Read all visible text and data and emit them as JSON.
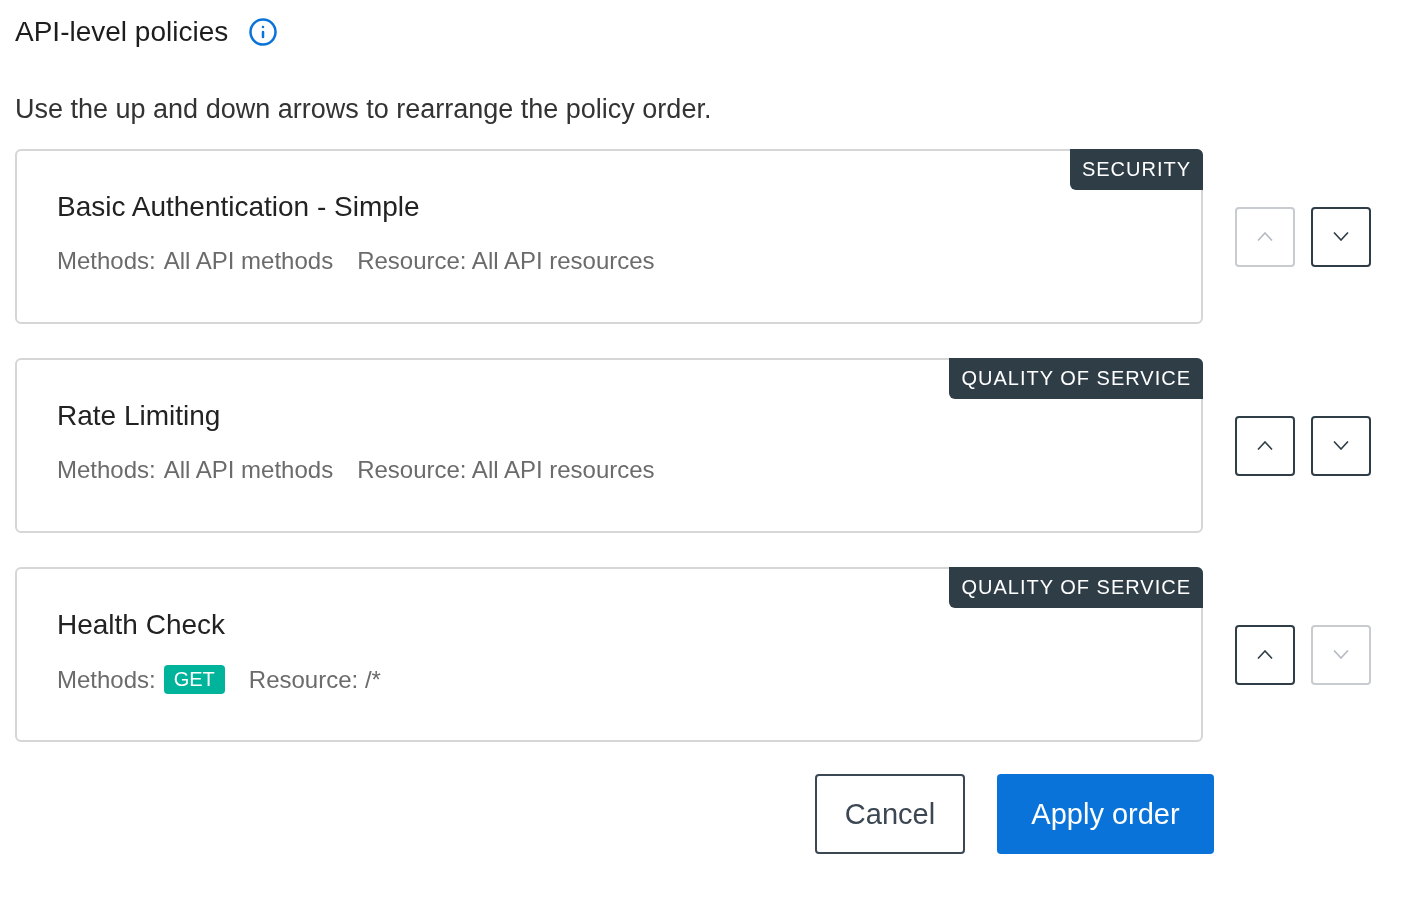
{
  "header": {
    "title": "API-level policies"
  },
  "instructions": "Use the up and down arrows to rearrange the policy order.",
  "policies": [
    {
      "name": "Basic Authentication - Simple",
      "category": "SECURITY",
      "methods_label": "Methods:",
      "methods": [
        {
          "kind": "text",
          "text": "All API methods"
        }
      ],
      "resource": "Resource: All API resources",
      "up_disabled": true,
      "down_disabled": false
    },
    {
      "name": "Rate Limiting",
      "category": "QUALITY OF SERVICE",
      "methods_label": "Methods:",
      "methods": [
        {
          "kind": "text",
          "text": "All API methods"
        }
      ],
      "resource": "Resource: All API resources",
      "up_disabled": false,
      "down_disabled": false
    },
    {
      "name": "Health Check",
      "category": "QUALITY OF SERVICE",
      "methods_label": "Methods:",
      "methods": [
        {
          "kind": "badge",
          "text": "GET"
        }
      ],
      "resource": "Resource: /*",
      "up_disabled": false,
      "down_disabled": true
    }
  ],
  "buttons": {
    "cancel": "Cancel",
    "apply": "Apply order"
  }
}
